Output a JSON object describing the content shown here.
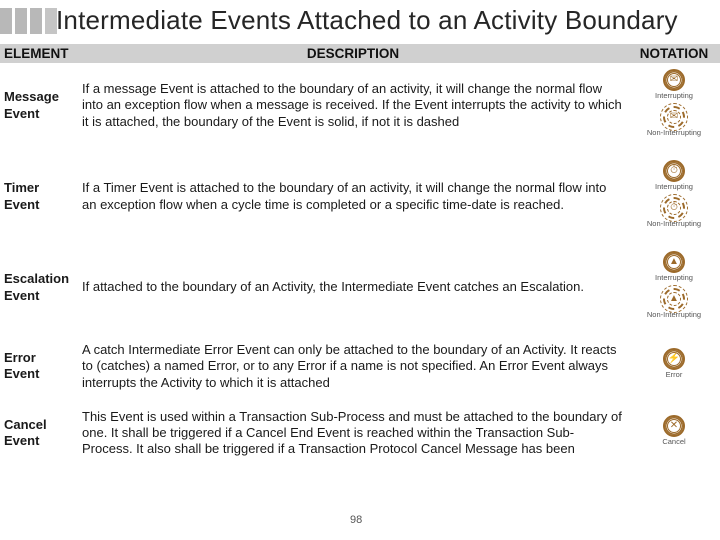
{
  "page": {
    "title": "Intermediate Events Attached to an Activity Boundary",
    "page_number": "98"
  },
  "table": {
    "headers": {
      "element": "ELEMENT",
      "description": "DESCRIPTION",
      "notation": "NOTATION"
    },
    "notation_labels": {
      "interrupt": "Interrupting",
      "noninterrupt": "Non-Interrupting",
      "error": "Error",
      "cancel": "Cancel"
    },
    "rows": [
      {
        "element": "Message Event",
        "description": "If a message Event is attached to the boundary of an activity, it will change the normal flow into an exception flow when a message is received.\nIf the Event interrupts the activity to which it is attached, the boundary of the Event is solid, if not it is dashed",
        "glyph": "✉",
        "notation": "pair"
      },
      {
        "element": "Timer Event",
        "description": "If a Timer Event is attached to the boundary of an activity, it will change the normal flow into an exception flow when a cycle time is completed or a specific time-date is reached.",
        "glyph": "⏱",
        "notation": "pair"
      },
      {
        "element": "Escalation Event",
        "description": "If attached to the boundary of an Activity, the Intermediate Event catches an Escalation.",
        "glyph": "▲",
        "notation": "pair"
      },
      {
        "element": "Error Event",
        "description": "A catch Intermediate Error Event can only be attached to the boundary of an Activity. It reacts to (catches) a named Error, or to any Error if a name is not specified. An Error Event always interrupts the Activity to which it is attached",
        "glyph": "⚡",
        "notation": "single-error"
      },
      {
        "element": "Cancel Event",
        "description": "This Event is used within a Transaction Sub-Process and must be attached to the boundary of one. It shall be triggered if a Cancel End Event is reached within the Transaction Sub-Process. It also shall be triggered if a Transaction Protocol Cancel Message has been",
        "glyph": "✕",
        "notation": "single-cancel"
      }
    ]
  }
}
